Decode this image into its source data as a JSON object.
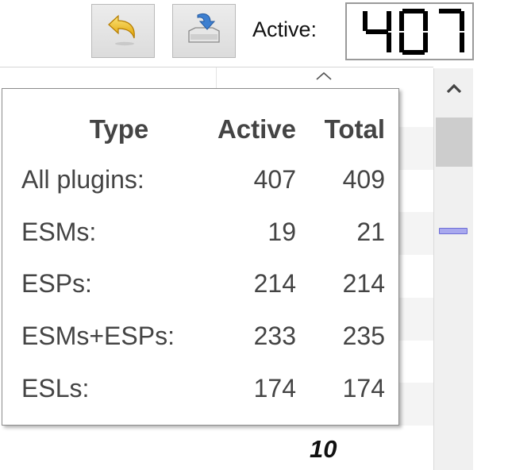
{
  "toolbar": {
    "undo_icon": "undo-arrow-icon",
    "save_icon": "save-tray-icon",
    "active_label": "Active:",
    "active_count": "407"
  },
  "list": {
    "bottom_value": "10"
  },
  "popup": {
    "headers": {
      "type": "Type",
      "active": "Active",
      "total": "Total"
    },
    "rows": [
      {
        "type": "All plugins:",
        "active": "407",
        "total": "409"
      },
      {
        "type": "ESMs:",
        "active": "19",
        "total": "21"
      },
      {
        "type": "ESPs:",
        "active": "214",
        "total": "214"
      },
      {
        "type": "ESMs+ESPs:",
        "active": "233",
        "total": "235"
      },
      {
        "type": "ESLs:",
        "active": "174",
        "total": "174"
      }
    ]
  },
  "colors": {
    "counter_digits": "#000000",
    "scroll_marker": "#a8a8ee",
    "popup_text": "#444444"
  }
}
